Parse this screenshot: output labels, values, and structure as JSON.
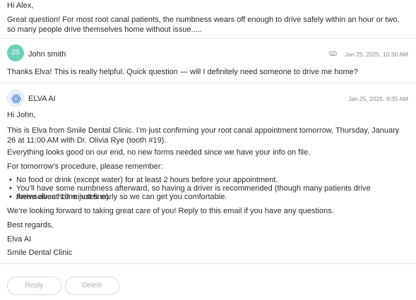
{
  "previous_message": {
    "greeting": "Hi Alex,",
    "body": "Great question! For most root canal patients, the numbness wears off enough to drive safely within an hour or two, so many people drive themselves home without issue....."
  },
  "reply_message": {
    "avatar_initials": "JS",
    "sender": "John smith",
    "attachment_icon": "paperclip-icon",
    "timestamp": "Jan 25, 2025, 10:30 AM",
    "body": "Thanks Elva! This is really helpful. Quick question — will I definitely need someone to drive me home?"
  },
  "elva_message": {
    "avatar_icon": "elva-logo-icon",
    "sender": "ELVA AI",
    "timestamp": "Jan 25, 2025, 9:35 AM",
    "greeting": "Hi John,",
    "intro": "This is Elva from Smile Dental Clinic. I’m just confirming your root canal appointment tomorrow, Thursday, January 26 at 11:00 AM with Dr. Olivia Rye (tooth #19).",
    "status": "Everything looks good on our end, no new forms needed since we have your info on file.",
    "remember_heading": "For tomorrow’s procedure, please remember:",
    "bullets": [
      "No food or drink (except water) for at least 2 hours before your appointment.",
      "You’ll have some numbness afterward, so having a driver is recommended (though many patients drive themselves home just fine).",
      "Arrive about 10 minutes early so we can get you comfortable."
    ],
    "closing": "We’re looking forward to taking great care of you! Reply to this email if you have any questions.",
    "signoff": "Best regards,",
    "signature_name": "Elva AI",
    "signature_clinic": "Smile Dental Clinic"
  },
  "actions": {
    "reply_label": "Reply",
    "delete_label": "Delete"
  },
  "colors": {
    "avatar_js": "#6ccfb9",
    "elva_icon": "#5b8fd8",
    "button_text": "#b0b0b0",
    "divider": "#e6e6e6"
  }
}
